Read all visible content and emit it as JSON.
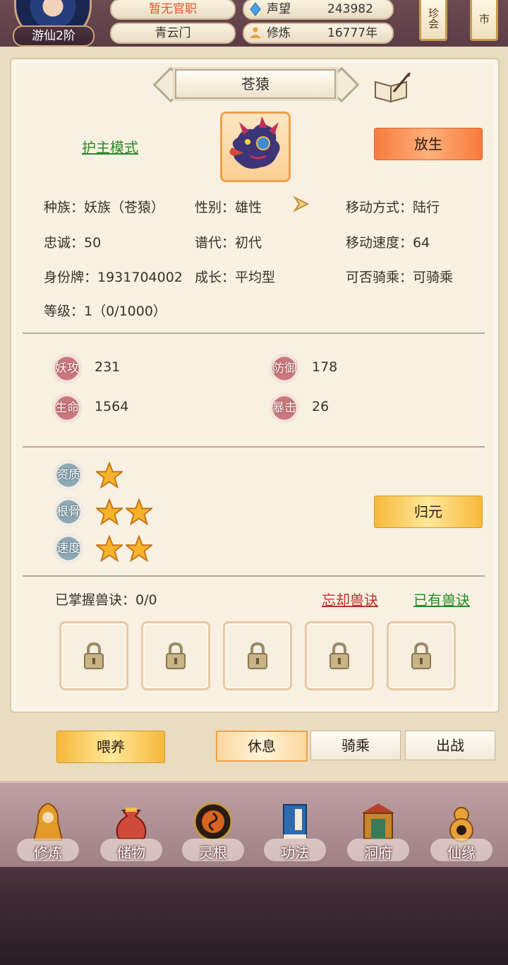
{
  "header": {
    "rank": "游仙2阶",
    "official_title": "暂无官职",
    "sect": "青云门",
    "stats": [
      {
        "label": "声望",
        "value": "243982",
        "icon": "diamond-icon"
      },
      {
        "label": "修炼",
        "value": "16777年",
        "icon": "meditation-icon"
      }
    ],
    "side_buttons": [
      "珍会",
      "市"
    ]
  },
  "pet": {
    "name": "苍猿",
    "mode_link": "护主模式",
    "release_button": "放生",
    "info": {
      "race": "种族：妖族（苍猿）",
      "gender": "性别：雄性",
      "move_type": "移动方式：陆行",
      "loyalty": "忠诚：50",
      "generation": "谱代：初代",
      "move_speed": "移动速度：64",
      "id_tag": "身份牌：1931704002",
      "growth": "成长：平均型",
      "rideable": "可否骑乘：可骑乘",
      "level": "等级：1（0/1000）"
    },
    "stats": [
      {
        "label": "妖攻",
        "value": "231"
      },
      {
        "label": "防御",
        "value": "178"
      },
      {
        "label": "生命",
        "value": "1564"
      },
      {
        "label": "暴击",
        "value": "26"
      }
    ],
    "aptitudes": [
      {
        "label": "资质",
        "stars": 1
      },
      {
        "label": "根骨",
        "stars": 2
      },
      {
        "label": "速度",
        "stars": 2
      }
    ],
    "reset_button": "归元",
    "skills": {
      "mastered": "已掌握兽诀：0/0",
      "forget_link": "忘却兽诀",
      "owned_link": "已有兽诀",
      "slots": 5
    }
  },
  "actions": {
    "feed": "喂养",
    "tabs": [
      "休息",
      "骑乘",
      "出战"
    ],
    "active_tab": 0
  },
  "nav": [
    {
      "label": "修炼",
      "icon": "cultivate-icon"
    },
    {
      "label": "储物",
      "icon": "bag-icon"
    },
    {
      "label": "灵根",
      "icon": "spirit-root-icon"
    },
    {
      "label": "功法",
      "icon": "book-icon"
    },
    {
      "label": "洞府",
      "icon": "cave-house-icon"
    },
    {
      "label": "仙缘",
      "icon": "gourd-icon"
    }
  ],
  "colors": {
    "accent_orange": "#f77a3e",
    "gold": "#f6b93a",
    "link_green": "#2a8a2a",
    "link_red": "#c0302a",
    "official_red": "#e05a2a"
  }
}
